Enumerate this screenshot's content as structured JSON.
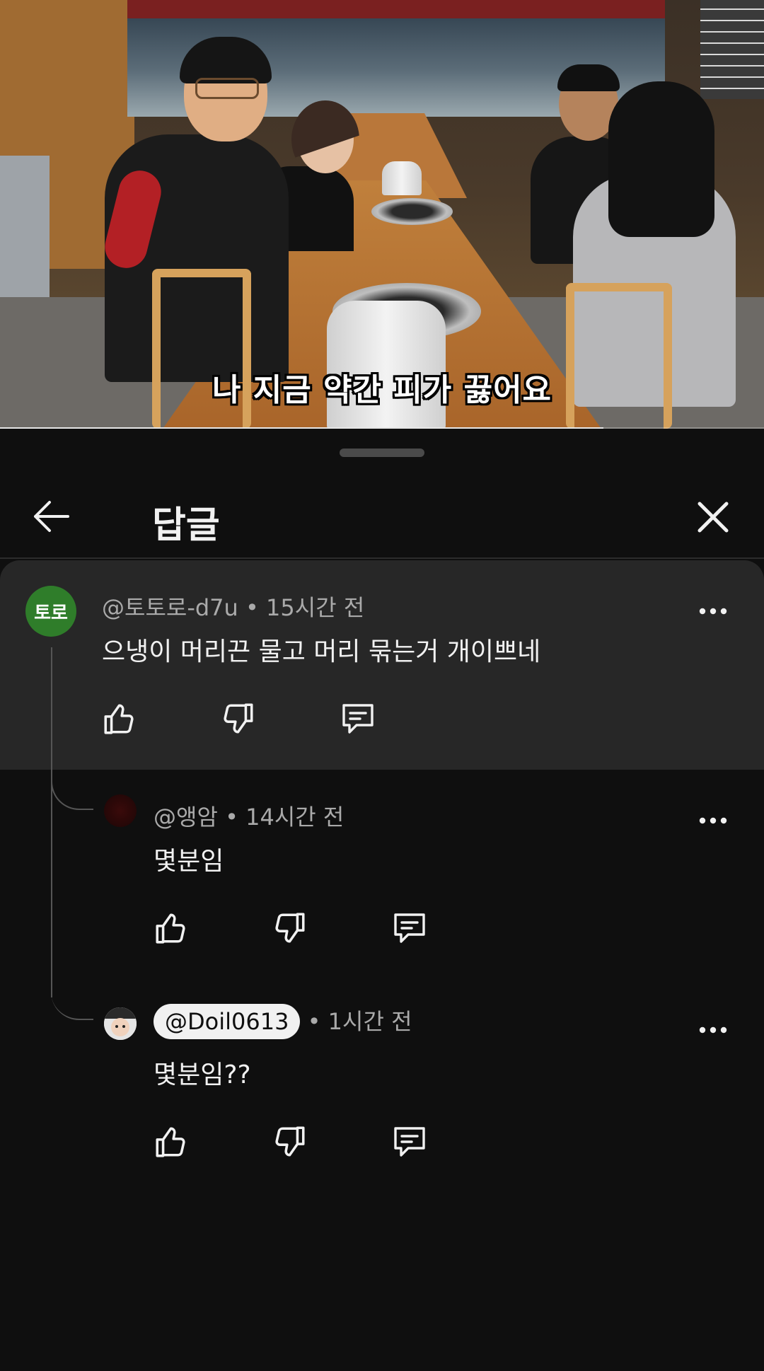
{
  "video": {
    "subtitle": "나 지금 약간 피가 끓어요",
    "progress": 0.79
  },
  "sheet": {
    "title": "답글",
    "back_icon": "arrow-left-icon",
    "close_icon": "close-icon"
  },
  "comments": [
    {
      "avatar_text": "토로",
      "avatar_color": "#2f7d2a",
      "author": "@토토로-d7u",
      "time": "15시간 전",
      "text": "으냉이 머리끈 물고 머리 묶는거 개이쁘네",
      "highlighted": true
    },
    {
      "author": "@앵암",
      "time": "14시간 전",
      "text": "몇분임",
      "highlighted": false
    },
    {
      "author": "@Doil0613",
      "time": "1시간 전",
      "text": "몇분임??",
      "highlighted": false,
      "author_pill": true
    }
  ],
  "separator": "•",
  "icons": {
    "like": "thumbs-up-icon",
    "dislike": "thumbs-down-icon",
    "reply": "reply-icon",
    "more": "more-vertical-dots-icon"
  },
  "colors": {
    "background": "#0f0f0f",
    "highlight": "#272727",
    "meta_text": "#aaaaaa"
  }
}
